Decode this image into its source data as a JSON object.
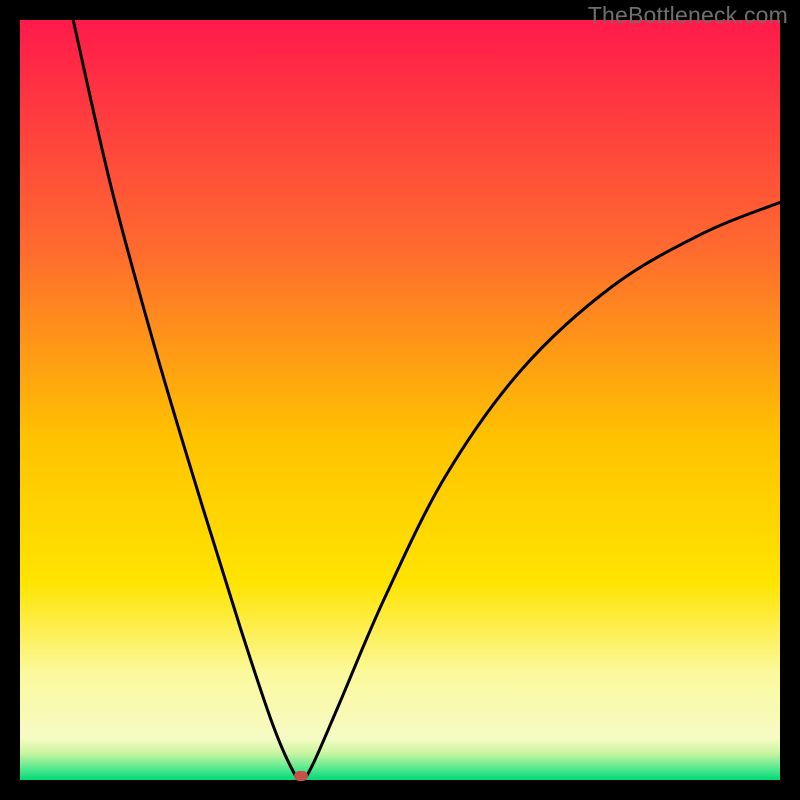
{
  "watermark": "TheBottleneck.com",
  "chart_data": {
    "type": "line",
    "title": "",
    "xlabel": "",
    "ylabel": "",
    "xlim": [
      0,
      100
    ],
    "ylim": [
      0,
      100
    ],
    "gradient_stops": [
      {
        "offset": 0,
        "color": "#ff1a4b"
      },
      {
        "offset": 0.3,
        "color": "#ff6a2f"
      },
      {
        "offset": 0.55,
        "color": "#ffc200"
      },
      {
        "offset": 0.74,
        "color": "#ffe400"
      },
      {
        "offset": 0.86,
        "color": "#fbf99d"
      },
      {
        "offset": 0.945,
        "color": "#f6fbc4"
      },
      {
        "offset": 0.965,
        "color": "#c9f5a0"
      },
      {
        "offset": 0.985,
        "color": "#54e98e"
      },
      {
        "offset": 1.0,
        "color": "#00d977"
      }
    ],
    "series": [
      {
        "name": "bottleneck-curve",
        "points": [
          {
            "x": 7.0,
            "y": 100.0
          },
          {
            "x": 12.0,
            "y": 78.0
          },
          {
            "x": 18.0,
            "y": 56.0
          },
          {
            "x": 24.0,
            "y": 36.0
          },
          {
            "x": 29.0,
            "y": 20.0
          },
          {
            "x": 33.0,
            "y": 8.0
          },
          {
            "x": 35.5,
            "y": 2.0
          },
          {
            "x": 37.0,
            "y": 0.0
          },
          {
            "x": 38.5,
            "y": 2.0
          },
          {
            "x": 42.0,
            "y": 10.0
          },
          {
            "x": 48.0,
            "y": 24.0
          },
          {
            "x": 56.0,
            "y": 40.0
          },
          {
            "x": 66.0,
            "y": 54.0
          },
          {
            "x": 78.0,
            "y": 65.0
          },
          {
            "x": 90.0,
            "y": 72.0
          },
          {
            "x": 100.0,
            "y": 76.0
          }
        ]
      }
    ],
    "marker": {
      "x": 37.0,
      "y": 0.5,
      "color": "#c55149"
    }
  }
}
